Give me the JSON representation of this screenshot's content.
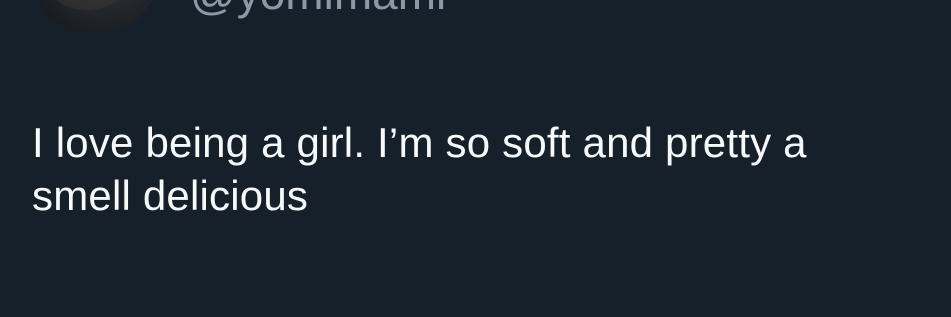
{
  "tweet": {
    "handle": "@yomimami",
    "text_lines": [
      "I love being a girl. I’m so soft and pretty a",
      "smell delicious"
    ]
  }
}
